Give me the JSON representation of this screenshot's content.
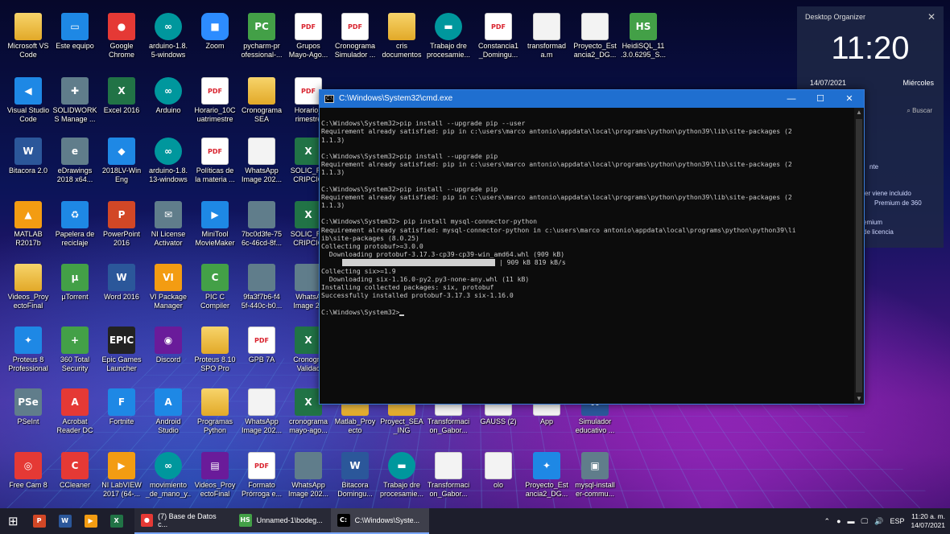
{
  "desktop": {
    "icons": [
      {
        "label": "Microsoft VS\nCode",
        "glyph": "",
        "kind": "folder",
        "col": 0,
        "row": 0
      },
      {
        "label": "Este equipo",
        "glyph": "▭",
        "kind": "blue",
        "col": 1,
        "row": 0
      },
      {
        "label": "Google\nChrome",
        "glyph": "●",
        "kind": "red",
        "col": 2,
        "row": 0
      },
      {
        "label": "arduino-1.8.\n5-windows",
        "glyph": "∞",
        "kind": "teal",
        "col": 3,
        "row": 0
      },
      {
        "label": "Zoom",
        "glyph": "■",
        "kind": "zoom",
        "col": 4,
        "row": 0
      },
      {
        "label": "pycharm-pr\nofessional-...",
        "glyph": "PC",
        "kind": "green",
        "col": 5,
        "row": 0
      },
      {
        "label": "Grupos\nMayo-Ago...",
        "glyph": "PDF",
        "kind": "pdf",
        "col": 6,
        "row": 0
      },
      {
        "label": "Cronograma\nSimulador ...",
        "glyph": "PDF",
        "kind": "pdf",
        "col": 7,
        "row": 0
      },
      {
        "label": "cris\ndocumentos",
        "glyph": "",
        "kind": "folder",
        "col": 8,
        "row": 0
      },
      {
        "label": "Trabajo dre\nprocesamie...",
        "glyph": "▬",
        "kind": "teal",
        "col": 9,
        "row": 0
      },
      {
        "label": "Constancia1\n_Domingu...",
        "glyph": "PDF",
        "kind": "pdf",
        "col": 10,
        "row": 0
      },
      {
        "label": "transformad\na.m",
        "glyph": "",
        "kind": "doc",
        "col": 11,
        "row": 0
      },
      {
        "label": "Proyecto_Est\nancia2_DG...",
        "glyph": "",
        "kind": "doc",
        "col": 12,
        "row": 0
      },
      {
        "label": "HeidiSQL_11\n.3.0.6295_S...",
        "glyph": "HS",
        "kind": "green",
        "col": 13,
        "row": 0
      },
      {
        "label": "Visual Studio\nCode",
        "glyph": "◀",
        "kind": "blue",
        "col": 0,
        "row": 1
      },
      {
        "label": "SOLIDWORK\nS Manage ...",
        "glyph": "✚",
        "kind": "gray",
        "col": 1,
        "row": 1
      },
      {
        "label": "Excel 2016",
        "glyph": "X",
        "kind": "excel",
        "col": 2,
        "row": 1
      },
      {
        "label": "Arduino",
        "glyph": "∞",
        "kind": "teal",
        "col": 3,
        "row": 1
      },
      {
        "label": "Horario_10C\nuatrimestre",
        "glyph": "PDF",
        "kind": "pdf",
        "col": 4,
        "row": 1
      },
      {
        "label": "Cronograma\nSEA",
        "glyph": "",
        "kind": "folder",
        "col": 5,
        "row": 1
      },
      {
        "label": "Horario_\nrimestre",
        "glyph": "PDF",
        "kind": "pdf",
        "col": 6,
        "row": 1
      },
      {
        "label": "Bitacora 2.0",
        "glyph": "W",
        "kind": "word",
        "col": 0,
        "row": 2
      },
      {
        "label": "eDrawings\n2018 x64...",
        "glyph": "e",
        "kind": "gray",
        "col": 1,
        "row": 2
      },
      {
        "label": "2018LV-Win\nEng",
        "glyph": "◆",
        "kind": "blue",
        "col": 2,
        "row": 2
      },
      {
        "label": "arduino-1.8.\n13-windows",
        "glyph": "∞",
        "kind": "teal",
        "col": 3,
        "row": 2
      },
      {
        "label": "Políticas de\nla materia ...",
        "glyph": "PDF",
        "kind": "pdf",
        "col": 4,
        "row": 2
      },
      {
        "label": "WhatsApp\nImage 202...",
        "glyph": "",
        "kind": "doc",
        "col": 5,
        "row": 2
      },
      {
        "label": "SOLIC_RE\nCRIPCIO",
        "glyph": "X",
        "kind": "excel",
        "col": 6,
        "row": 2
      },
      {
        "label": "MATLAB\nR2017b",
        "glyph": "▲",
        "kind": "orange",
        "col": 0,
        "row": 3
      },
      {
        "label": "Papelera de\nreciclaje",
        "glyph": "♻",
        "kind": "blue",
        "col": 1,
        "row": 3
      },
      {
        "label": "PowerPoint\n2016",
        "glyph": "P",
        "kind": "ppt",
        "col": 2,
        "row": 3
      },
      {
        "label": "NI License\nActivator",
        "glyph": "✉",
        "kind": "gray",
        "col": 3,
        "row": 3
      },
      {
        "label": "MiniTool\nMovieMaker",
        "glyph": "▶",
        "kind": "blue",
        "col": 4,
        "row": 3
      },
      {
        "label": "7bc0d3fe-75\n6c-46cd-8f...",
        "glyph": "",
        "kind": "gray",
        "col": 5,
        "row": 3
      },
      {
        "label": "SOLIC_RE\nCRIPCIO",
        "glyph": "X",
        "kind": "excel",
        "col": 6,
        "row": 3
      },
      {
        "label": "Videos_Proy\nectoFinal",
        "glyph": "",
        "kind": "folder",
        "col": 0,
        "row": 4
      },
      {
        "label": "µTorrent",
        "glyph": "µ",
        "kind": "green",
        "col": 1,
        "row": 4
      },
      {
        "label": "Word 2016",
        "glyph": "W",
        "kind": "word",
        "col": 2,
        "row": 4
      },
      {
        "label": "VI Package\nManager",
        "glyph": "VI",
        "kind": "orange",
        "col": 3,
        "row": 4
      },
      {
        "label": "PIC C\nCompiler",
        "glyph": "C",
        "kind": "green",
        "col": 4,
        "row": 4
      },
      {
        "label": "9fa3f7b6-f4\n5f-440c-b0...",
        "glyph": "",
        "kind": "gray",
        "col": 5,
        "row": 4
      },
      {
        "label": "WhatsA\nImage 20",
        "glyph": "",
        "kind": "gray",
        "col": 6,
        "row": 4
      },
      {
        "label": "Proteus 8\nProfessional",
        "glyph": "✦",
        "kind": "blue",
        "col": 0,
        "row": 5
      },
      {
        "label": "360 Total\nSecurity",
        "glyph": "+",
        "kind": "green",
        "col": 1,
        "row": 5
      },
      {
        "label": "Epic Games\nLauncher",
        "glyph": "EPIC",
        "kind": "dark",
        "col": 2,
        "row": 5
      },
      {
        "label": "Discord",
        "glyph": "◉",
        "kind": "purple",
        "col": 3,
        "row": 5
      },
      {
        "label": "Proteus 8.10\nSPO Pro",
        "glyph": "",
        "kind": "folder",
        "col": 4,
        "row": 5
      },
      {
        "label": "GPB 7A",
        "glyph": "PDF",
        "kind": "pdf",
        "col": 5,
        "row": 5
      },
      {
        "label": "Cronogra\nValidac",
        "glyph": "X",
        "kind": "excel",
        "col": 6,
        "row": 5
      },
      {
        "label": "PSeInt",
        "glyph": "PSe",
        "kind": "gray",
        "col": 0,
        "row": 6
      },
      {
        "label": "Acrobat\nReader DC",
        "glyph": "A",
        "kind": "red",
        "col": 1,
        "row": 6
      },
      {
        "label": "Fortnite",
        "glyph": "F",
        "kind": "blue",
        "col": 2,
        "row": 6
      },
      {
        "label": "Android\nStudio",
        "glyph": "A",
        "kind": "blue",
        "col": 3,
        "row": 6
      },
      {
        "label": "Programas\nPython",
        "glyph": "",
        "kind": "folder",
        "col": 4,
        "row": 6
      },
      {
        "label": "WhatsApp\nImage 202...",
        "glyph": "",
        "kind": "doc",
        "col": 5,
        "row": 6
      },
      {
        "label": "cronograma\nmayo-ago...",
        "glyph": "X",
        "kind": "excel",
        "col": 6,
        "row": 6
      },
      {
        "label": "Matlab_Proy\necto",
        "glyph": "",
        "kind": "folder",
        "col": 7,
        "row": 6
      },
      {
        "label": "Proyect_SEA\n_ING",
        "glyph": "",
        "kind": "folder",
        "col": 8,
        "row": 6
      },
      {
        "label": "Transformaci\non_Gabor...",
        "glyph": "",
        "kind": "doc",
        "col": 9,
        "row": 6
      },
      {
        "label": "GAUSS (2)",
        "glyph": "",
        "kind": "doc",
        "col": 10,
        "row": 6
      },
      {
        "label": "App",
        "glyph": "",
        "kind": "doc",
        "col": 11,
        "row": 6
      },
      {
        "label": "Simulador\neducativo ...",
        "glyph": "W",
        "kind": "word",
        "col": 12,
        "row": 6
      },
      {
        "label": "Free Cam 8",
        "glyph": "◎",
        "kind": "red",
        "col": 0,
        "row": 7
      },
      {
        "label": "CCleaner",
        "glyph": "C",
        "kind": "red",
        "col": 1,
        "row": 7
      },
      {
        "label": "NI LabVIEW\n2017 (64-...",
        "glyph": "▶",
        "kind": "orange",
        "col": 2,
        "row": 7
      },
      {
        "label": "movimiento\n_de_mano_y...",
        "glyph": "∞",
        "kind": "teal",
        "col": 3,
        "row": 7
      },
      {
        "label": "Videos_Proy\nectoFinal",
        "glyph": "▤",
        "kind": "purple",
        "col": 4,
        "row": 7
      },
      {
        "label": "Formato\nPrórroga e...",
        "glyph": "PDF",
        "kind": "pdf",
        "col": 5,
        "row": 7
      },
      {
        "label": "WhatsApp\nImage 202...",
        "glyph": "",
        "kind": "gray",
        "col": 6,
        "row": 7
      },
      {
        "label": "Bitacora\nDomingu...",
        "glyph": "W",
        "kind": "word",
        "col": 7,
        "row": 7
      },
      {
        "label": "Trabajo dre\nprocesamie...",
        "glyph": "▬",
        "kind": "teal",
        "col": 8,
        "row": 7
      },
      {
        "label": "Transformaci\non_Gabor...",
        "glyph": "",
        "kind": "doc",
        "col": 9,
        "row": 7
      },
      {
        "label": "olo",
        "glyph": "",
        "kind": "doc",
        "col": 10,
        "row": 7
      },
      {
        "label": "Proyecto_Est\nancia2_DG...",
        "glyph": "✦",
        "kind": "blue",
        "col": 11,
        "row": 7
      },
      {
        "label": "mysql-install\ner-commu...",
        "glyph": "▣",
        "kind": "gray",
        "col": 12,
        "row": 7
      }
    ]
  },
  "cmd": {
    "title": "C:\\Windows\\System32\\cmd.exe",
    "icon_glyph": "C:\\",
    "minimize_glyph": "—",
    "maximize_glyph": "☐",
    "close_glyph": "✕",
    "lines": [
      "",
      "C:\\Windows\\System32>pip install --upgrade pip --user",
      "Requirement already satisfied: pip in c:\\users\\marco antonio\\appdata\\local\\programs\\python\\python39\\lib\\site-packages (2",
      "1.1.3)",
      "",
      "C:\\Windows\\System32>pip install --upgrade pip",
      "Requirement already satisfied: pip in c:\\users\\marco antonio\\appdata\\local\\programs\\python\\python39\\lib\\site-packages (2",
      "1.1.3)",
      "",
      "C:\\Windows\\System32>pip install --upgrade pip",
      "Requirement already satisfied: pip in c:\\users\\marco antonio\\appdata\\local\\programs\\python\\python39\\lib\\site-packages (2",
      "1.1.3)",
      "",
      "C:\\Windows\\System32> pip install mysql-connector-python",
      "Requirement already satisfied: mysql-connector-python in c:\\users\\marco antonio\\appdata\\local\\programs\\python\\python39\\li",
      "ib\\site-packages (8.0.25)",
      "Collecting protobuf>=3.0.0",
      "  Downloading protobuf-3.17.3-cp39-cp39-win_amd64.whl (909 kB)"
    ],
    "progress_text": "| 909 kB 819 kB/s",
    "progress_fraction": 1.0,
    "lines_after": [
      "Collecting six>=1.9",
      "  Downloading six-1.16.0-py2.py3-none-any.whl (11 kB)",
      "Installing collected packages: six, protobuf",
      "Successfully installed protobuf-3.17.3 six-1.16.0",
      "",
      "C:\\Windows\\System32>"
    ]
  },
  "organizer": {
    "title": "Desktop Organizer",
    "close": "✕",
    "clock": "11:20",
    "date": "14/07/2021",
    "day": "Miércoles",
    "search": "Buscar",
    "partial_1": "nte",
    "partial_2": "zer viene incluido",
    "partial_3": "Premium de 360",
    "partial_4": "emium",
    "partial_5": "de licencia"
  },
  "taskbar": {
    "start_glyph": "⊞",
    "pinned": [
      {
        "glyph": "P",
        "color": "#d24726"
      },
      {
        "glyph": "W",
        "color": "#2b579a"
      },
      {
        "glyph": "▶",
        "color": "#f39c12"
      },
      {
        "glyph": "X",
        "color": "#217346"
      }
    ],
    "apps": [
      {
        "label": "(7) Base de Datos c...",
        "glyph": "●",
        "color": "#e53935"
      },
      {
        "label": "Unnamed-1\\bodeg...",
        "glyph": "HS",
        "color": "#43a047"
      },
      {
        "label": "C:\\Windows\\Syste...",
        "glyph": "C:",
        "color": "#000000"
      }
    ],
    "tray": {
      "icons": [
        "⌃",
        "●",
        "▬",
        "🖵",
        "🔊"
      ],
      "lang": "ESP",
      "time": "11:20 a. m.",
      "date": "14/07/2021"
    }
  }
}
